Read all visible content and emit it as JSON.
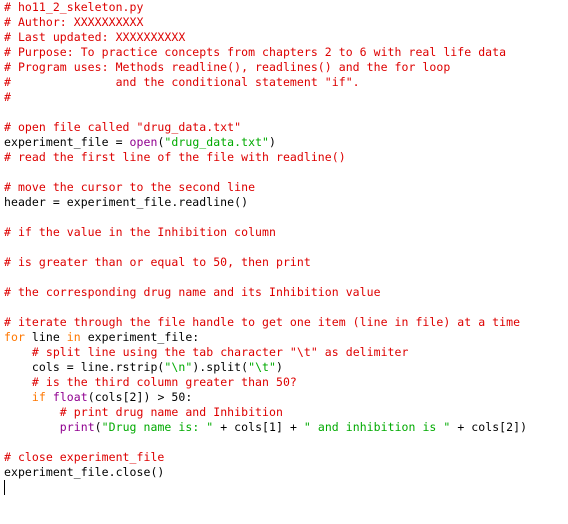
{
  "editor": {
    "colors": {
      "comment": "#dd0000",
      "keyword": "#ff7700",
      "builtin": "#900090",
      "string": "#00aa00",
      "plain": "#000000"
    },
    "lines": [
      [
        {
          "t": "comment",
          "v": "# ho11_2_skeleton.py"
        }
      ],
      [
        {
          "t": "comment",
          "v": "# Author: XXXXXXXXXX"
        }
      ],
      [
        {
          "t": "comment",
          "v": "# Last updated: XXXXXXXXXX"
        }
      ],
      [
        {
          "t": "comment",
          "v": "# Purpose: To practice concepts from chapters 2 to 6 with real life data"
        }
      ],
      [
        {
          "t": "comment",
          "v": "# Program uses: Methods readline(), readlines() and the for loop"
        }
      ],
      [
        {
          "t": "comment",
          "v": "#               and the conditional statement \"if\"."
        }
      ],
      [
        {
          "t": "comment",
          "v": "#"
        }
      ],
      [],
      [
        {
          "t": "comment",
          "v": "# open file called \"drug_data.txt\""
        }
      ],
      [
        {
          "t": "plain",
          "v": "experiment_file = "
        },
        {
          "t": "builtin",
          "v": "open"
        },
        {
          "t": "plain",
          "v": "("
        },
        {
          "t": "string",
          "v": "\"drug_data.txt\""
        },
        {
          "t": "plain",
          "v": ")"
        }
      ],
      [
        {
          "t": "comment",
          "v": "# read the first line of the file with readline()"
        }
      ],
      [],
      [
        {
          "t": "comment",
          "v": "# move the cursor to the second line"
        }
      ],
      [
        {
          "t": "plain",
          "v": "header = experiment_file.readline()"
        }
      ],
      [],
      [
        {
          "t": "comment",
          "v": "# if the value in the Inhibition column"
        }
      ],
      [],
      [
        {
          "t": "comment",
          "v": "# is greater than or equal to 50, then print"
        }
      ],
      [],
      [
        {
          "t": "comment",
          "v": "# the corresponding drug name and its Inhibition value"
        }
      ],
      [],
      [
        {
          "t": "comment",
          "v": "# iterate through the file handle to get one item (line in file) at a time"
        }
      ],
      [
        {
          "t": "keyword",
          "v": "for"
        },
        {
          "t": "plain",
          "v": " line "
        },
        {
          "t": "keyword",
          "v": "in"
        },
        {
          "t": "plain",
          "v": " experiment_file:"
        }
      ],
      [
        {
          "t": "plain",
          "v": "    "
        },
        {
          "t": "comment",
          "v": "# split line using the tab character \"\\t\" as delimiter"
        }
      ],
      [
        {
          "t": "plain",
          "v": "    cols = line.rstrip("
        },
        {
          "t": "string",
          "v": "\"\\n\""
        },
        {
          "t": "plain",
          "v": ").split("
        },
        {
          "t": "string",
          "v": "\"\\t\""
        },
        {
          "t": "plain",
          "v": ")"
        }
      ],
      [
        {
          "t": "plain",
          "v": "    "
        },
        {
          "t": "comment",
          "v": "# is the third column greater than 50?"
        }
      ],
      [
        {
          "t": "plain",
          "v": "    "
        },
        {
          "t": "keyword",
          "v": "if"
        },
        {
          "t": "plain",
          "v": " "
        },
        {
          "t": "builtin",
          "v": "float"
        },
        {
          "t": "plain",
          "v": "(cols[2]) > 50:"
        }
      ],
      [
        {
          "t": "plain",
          "v": "        "
        },
        {
          "t": "comment",
          "v": "# print drug name and Inhibition"
        }
      ],
      [
        {
          "t": "plain",
          "v": "        "
        },
        {
          "t": "builtin",
          "v": "print"
        },
        {
          "t": "plain",
          "v": "("
        },
        {
          "t": "string",
          "v": "\"Drug name is: \""
        },
        {
          "t": "plain",
          "v": " + cols[1] + "
        },
        {
          "t": "string",
          "v": "\" and inhibition is \""
        },
        {
          "t": "plain",
          "v": " + cols[2])"
        }
      ],
      [],
      [
        {
          "t": "comment",
          "v": "# close experiment_file"
        }
      ],
      [
        {
          "t": "plain",
          "v": "experiment_file.close()"
        }
      ],
      [
        {
          "t": "cursor",
          "v": ""
        }
      ]
    ]
  }
}
